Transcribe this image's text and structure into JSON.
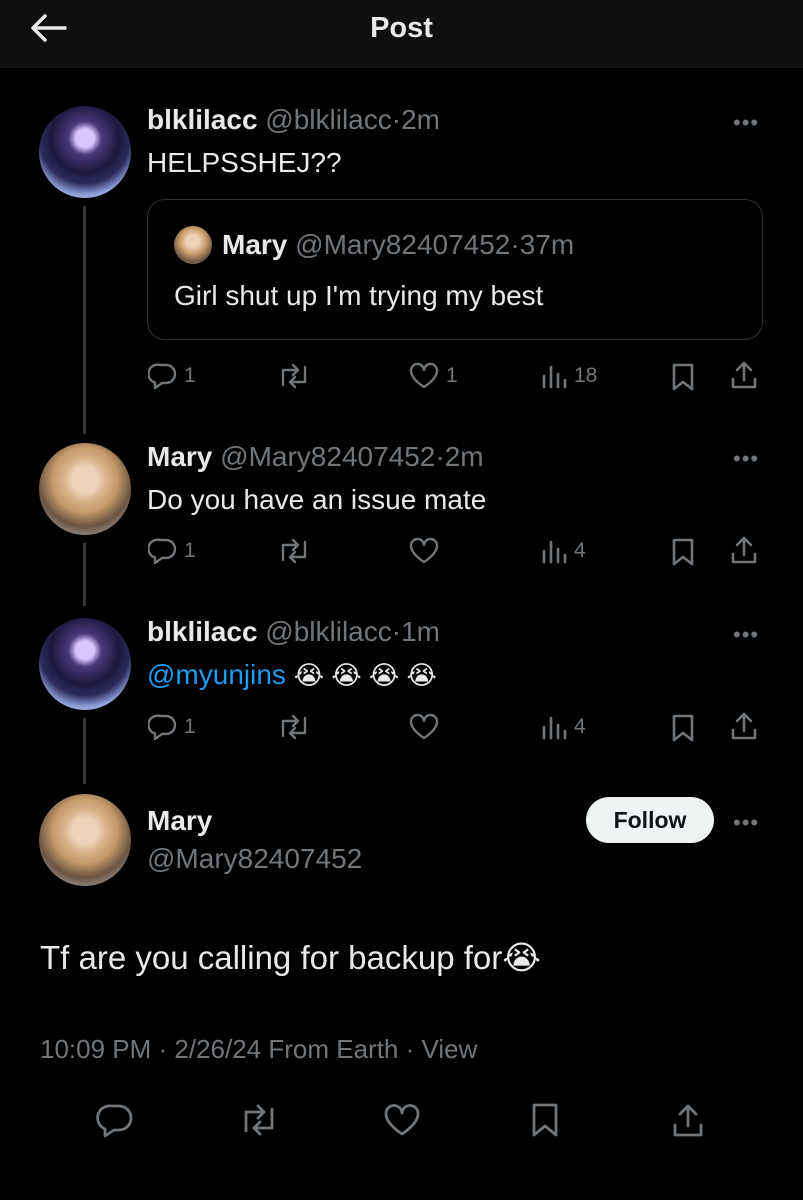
{
  "header": {
    "title": "Post"
  },
  "replies": [
    {
      "name": "blklilacc",
      "handle": "@blklilacc",
      "sep": "·",
      "time": "2m",
      "text": "HELPSSHEJ??",
      "quote": {
        "name": "Mary",
        "handle": "@Mary82407452",
        "sep": "·",
        "time": "37m",
        "text": "Girl shut up I'm trying my best"
      },
      "stats": {
        "replies": "1",
        "reposts": "",
        "likes": "1",
        "views": "18"
      }
    },
    {
      "name": "Mary",
      "handle": "@Mary82407452",
      "sep": "·",
      "time": "2m",
      "text": "Do you have an issue mate",
      "stats": {
        "replies": "1",
        "reposts": "",
        "likes": "",
        "views": "4"
      }
    },
    {
      "name": "blklilacc",
      "handle": "@blklilacc",
      "sep": "·",
      "time": "1m",
      "mention": "@myunjins",
      "emojis": "😭 😭 😭 😭",
      "stats": {
        "replies": "1",
        "reposts": "",
        "likes": "",
        "views": "4"
      }
    }
  ],
  "main_post": {
    "name": "Mary",
    "handle": "@Mary82407452",
    "follow_label": "Follow",
    "text": "Tf are you calling for backup for😭",
    "timestamp": "10:09 PM · 2/26/24 From Earth · View"
  },
  "more_label": "•••",
  "colors": {
    "background": "#000000",
    "text": "#e7e9ea",
    "muted": "#71767b",
    "link": "#1d9bf0",
    "follow_bg": "#eff3f4"
  },
  "icons": [
    "back-arrow-icon",
    "more-icon",
    "reply-icon",
    "repost-icon",
    "like-icon",
    "views-icon",
    "bookmark-icon",
    "share-icon"
  ]
}
